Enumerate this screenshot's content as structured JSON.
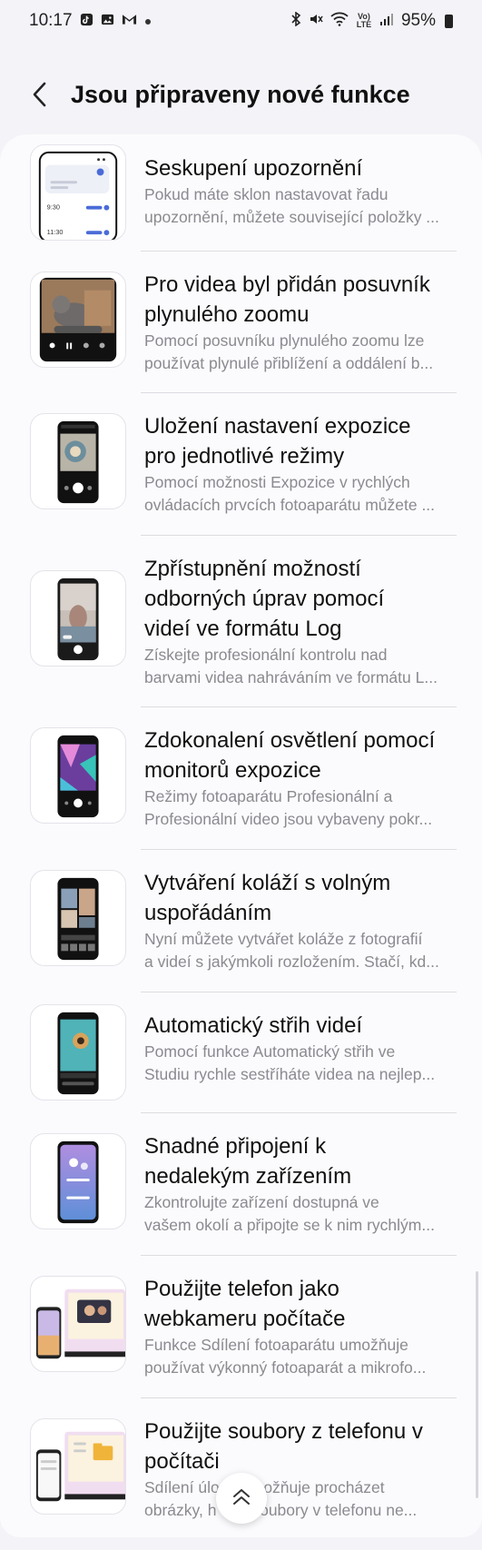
{
  "status_bar": {
    "time": "10:17",
    "battery": "95%",
    "left_icons": [
      "tiktok-icon",
      "gallery-icon",
      "gmail-icon",
      "dot-icon"
    ],
    "right_icons": [
      "bluetooth-icon",
      "mute-icon",
      "wifi-icon",
      "volte-icon",
      "signal-icon",
      "battery-icon"
    ],
    "lte_label": "Vo) LTE"
  },
  "header": {
    "title": "Jsou připraveny nové funkce"
  },
  "items": [
    {
      "title_lines": [
        "Seskupení upozornění"
      ],
      "desc_lines": [
        "Pokud máte sklon nastavovat řadu",
        "upozornění, můžete související položky ..."
      ],
      "thumb_texts": [
        "9:30",
        "11:30"
      ]
    },
    {
      "title_lines": [
        "Pro videa byl přidán posuvník",
        "plynulého zoomu"
      ],
      "desc_lines": [
        "Pomocí posuvníku plynulého zoomu lze",
        "používat plynulé přiblížení a oddálení b..."
      ]
    },
    {
      "title_lines": [
        "Uložení nastavení expozice",
        "pro jednotlivé režimy"
      ],
      "desc_lines": [
        "Pomocí možnosti Expozice v rychlých",
        "ovládacích prvcích fotoaparátu můžete ..."
      ]
    },
    {
      "title_lines": [
        "Zpřístupnění možností",
        "odborných úprav pomocí",
        "videí ve formátu Log"
      ],
      "desc_lines": [
        "Získejte profesionální kontrolu nad",
        "barvami videa nahráváním ve formátu L..."
      ]
    },
    {
      "title_lines": [
        "Zdokonalení osvětlení pomocí",
        "monitorů expozice"
      ],
      "desc_lines": [
        "Režimy fotoaparátu Profesionální a",
        "Profesionální video jsou vybaveny pokr..."
      ]
    },
    {
      "title_lines": [
        "Vytváření koláží s volným",
        "uspořádáním"
      ],
      "desc_lines": [
        "Nyní můžete vytvářet koláže z fotografií",
        "a videí s jakýmkoli rozložením. Stačí, kd..."
      ]
    },
    {
      "title_lines": [
        "Automatický střih videí"
      ],
      "desc_lines": [
        "Pomocí funkce Automatický střih ve",
        "Studiu rychle sestříháte videa na nejlep..."
      ]
    },
    {
      "title_lines": [
        "Snadné připojení k",
        "nedalekým zařízením"
      ],
      "desc_lines": [
        "Zkontrolujte zařízení dostupná ve",
        "vašem okolí a připojte se k nim rychlým..."
      ]
    },
    {
      "title_lines": [
        "Použijte telefon jako",
        "webkameru počítače"
      ],
      "desc_lines": [
        "Funkce Sdílení fotoaparátu umožňuje",
        "používat výkonný fotoaparát a mikrofo..."
      ]
    },
    {
      "title_lines": [
        "Použijte soubory z telefonu v",
        "počítači"
      ],
      "desc_lines": [
        "Sdílení úlo     umožňuje procházet",
        "obrázky, h     a soubory v telefonu ne..."
      ]
    }
  ],
  "colors": {
    "background": "#f4f3f8",
    "card": "#fbfbfd",
    "title_text": "#111111",
    "desc_text": "#8a8a90",
    "divider": "#dcdce2"
  }
}
